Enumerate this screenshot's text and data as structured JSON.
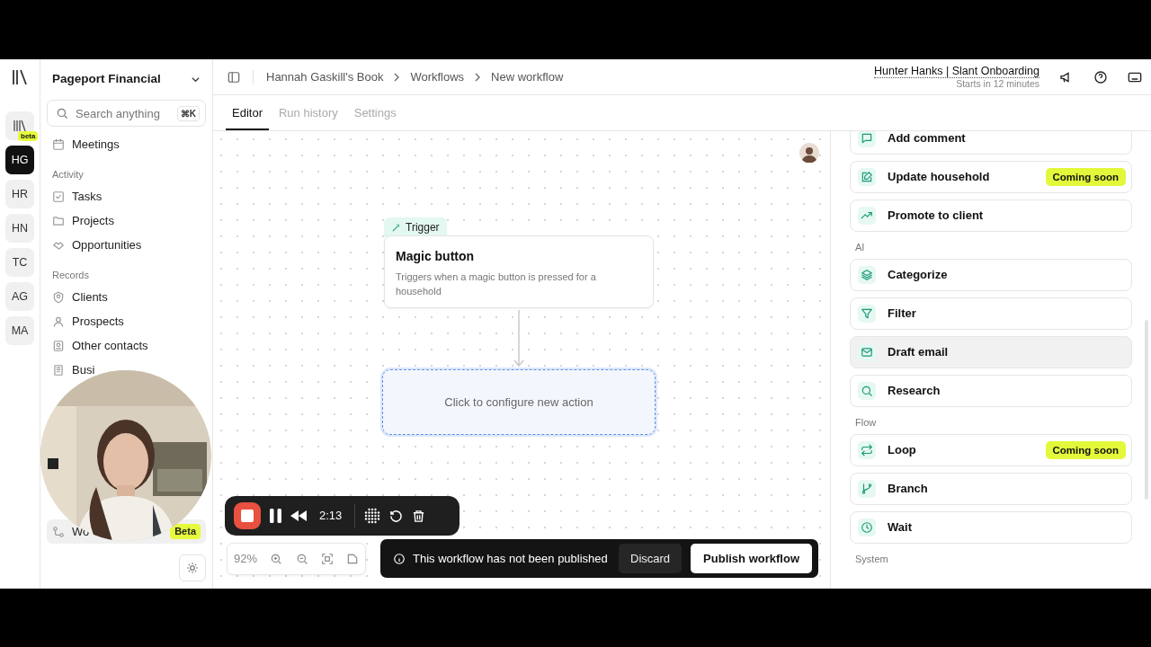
{
  "rail": {
    "items": [
      {
        "kind": "library",
        "badge": "beta",
        "selected": false
      },
      {
        "kind": "initials",
        "label": "HG",
        "selected": true
      },
      {
        "kind": "initials",
        "label": "HR",
        "selected": false
      },
      {
        "kind": "initials",
        "label": "HN",
        "selected": false
      },
      {
        "kind": "initials",
        "label": "TC",
        "selected": false
      },
      {
        "kind": "initials",
        "label": "AG",
        "selected": false
      },
      {
        "kind": "initials",
        "label": "MA",
        "selected": false
      }
    ]
  },
  "workspace": {
    "name": "Pageport Financial"
  },
  "search": {
    "placeholder": "Search anything",
    "shortcut": "⌘K"
  },
  "sidebar": {
    "sections": [
      {
        "items": [
          {
            "label": "Meetings",
            "kind": "calendar",
            "selected": false
          }
        ]
      },
      {
        "title": "Activity",
        "items": [
          {
            "label": "Tasks",
            "kind": "tasks",
            "selected": false
          },
          {
            "label": "Projects",
            "kind": "folder",
            "selected": false
          },
          {
            "label": "Opportunities",
            "kind": "deal",
            "selected": false
          }
        ]
      },
      {
        "title": "Records",
        "items": [
          {
            "label": "Clients",
            "kind": "client",
            "selected": false
          },
          {
            "label": "Prospects",
            "kind": "person",
            "selected": false
          },
          {
            "label": "Other contacts",
            "kind": "contact",
            "selected": false
          },
          {
            "label": "Busi",
            "kind": "building",
            "selected": false
          }
        ]
      },
      {
        "items": [
          {
            "label": "Wo",
            "kind": "workflow",
            "badge": "Beta",
            "selected": true
          }
        ]
      }
    ]
  },
  "breadcrumbs": [
    "Hannah Gaskill's Book",
    "Workflows",
    "New workflow"
  ],
  "meeting": {
    "title": "Hunter Hanks | Slant Onboarding",
    "subtitle": "Starts in 12 minutes"
  },
  "tabs": [
    {
      "label": "Editor",
      "selected": true
    },
    {
      "label": "Run history",
      "selected": false
    },
    {
      "label": "Settings",
      "selected": false
    }
  ],
  "trigger": {
    "tag": "Trigger",
    "title": "Magic button",
    "description": "Triggers when a magic button is pressed for a household"
  },
  "new_action": {
    "label": "Click to configure new action"
  },
  "recorder": {
    "time": "2:13"
  },
  "zoom": {
    "percent": "92%"
  },
  "publish_bar": {
    "message": "This workflow has not been published",
    "discard": "Discard",
    "publish": "Publish workflow"
  },
  "actions": [
    {
      "kind": "comment",
      "label": "Add comment",
      "hovered": false
    },
    {
      "kind": "edit",
      "label": "Update household",
      "badge": "Coming soon",
      "hovered": false
    },
    {
      "kind": "trend",
      "label": "Promote to client",
      "hovered": false
    },
    {
      "kind": "section",
      "label": "AI"
    },
    {
      "kind": "layers",
      "label": "Categorize",
      "hovered": false
    },
    {
      "kind": "filter",
      "label": "Filter",
      "hovered": false
    },
    {
      "kind": "mail",
      "label": "Draft email",
      "hovered": true
    },
    {
      "kind": "search",
      "label": "Research",
      "hovered": false
    },
    {
      "kind": "section",
      "label": "Flow"
    },
    {
      "kind": "loop",
      "label": "Loop",
      "badge": "Coming soon",
      "hovered": false
    },
    {
      "kind": "branch",
      "label": "Branch",
      "hovered": false
    },
    {
      "kind": "clock",
      "label": "Wait",
      "hovered": false
    },
    {
      "kind": "section",
      "label": "System"
    }
  ],
  "webcam": {
    "kind": "picture"
  }
}
